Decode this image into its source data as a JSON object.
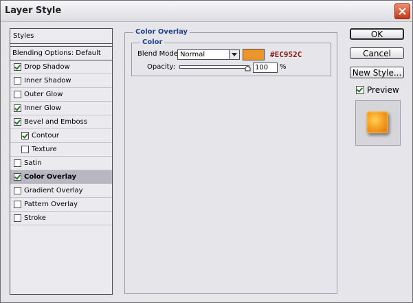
{
  "window": {
    "title": "Layer Style"
  },
  "styles": {
    "header": "Styles",
    "blending_options": "Blending Options: Default",
    "items": [
      {
        "label": "Drop Shadow",
        "checked": true,
        "indent": false,
        "selected": false
      },
      {
        "label": "Inner Shadow",
        "checked": false,
        "indent": false,
        "selected": false
      },
      {
        "label": "Outer Glow",
        "checked": false,
        "indent": false,
        "selected": false
      },
      {
        "label": "Inner Glow",
        "checked": true,
        "indent": false,
        "selected": false
      },
      {
        "label": "Bevel and Emboss",
        "checked": true,
        "indent": false,
        "selected": false
      },
      {
        "label": "Contour",
        "checked": true,
        "indent": true,
        "selected": false
      },
      {
        "label": "Texture",
        "checked": false,
        "indent": true,
        "selected": false
      },
      {
        "label": "Satin",
        "checked": false,
        "indent": false,
        "selected": false
      },
      {
        "label": "Color Overlay",
        "checked": true,
        "indent": false,
        "selected": true
      },
      {
        "label": "Gradient Overlay",
        "checked": false,
        "indent": false,
        "selected": false
      },
      {
        "label": "Pattern Overlay",
        "checked": false,
        "indent": false,
        "selected": false
      },
      {
        "label": "Stroke",
        "checked": false,
        "indent": false,
        "selected": false
      }
    ]
  },
  "panel": {
    "title": "Color Overlay",
    "group_title": "Color",
    "blend_mode_label": "Blend Mode:",
    "blend_mode_value": "Normal",
    "color_value": "#EC952C",
    "swatch_color": "#ec952c",
    "opacity_label": "Opacity:",
    "opacity_value": "100",
    "opacity_unit": "%",
    "opacity_fraction": 1.0
  },
  "buttons": {
    "ok": "OK",
    "cancel": "Cancel",
    "new_style": "New Style..."
  },
  "preview": {
    "label": "Preview",
    "checked": true
  }
}
